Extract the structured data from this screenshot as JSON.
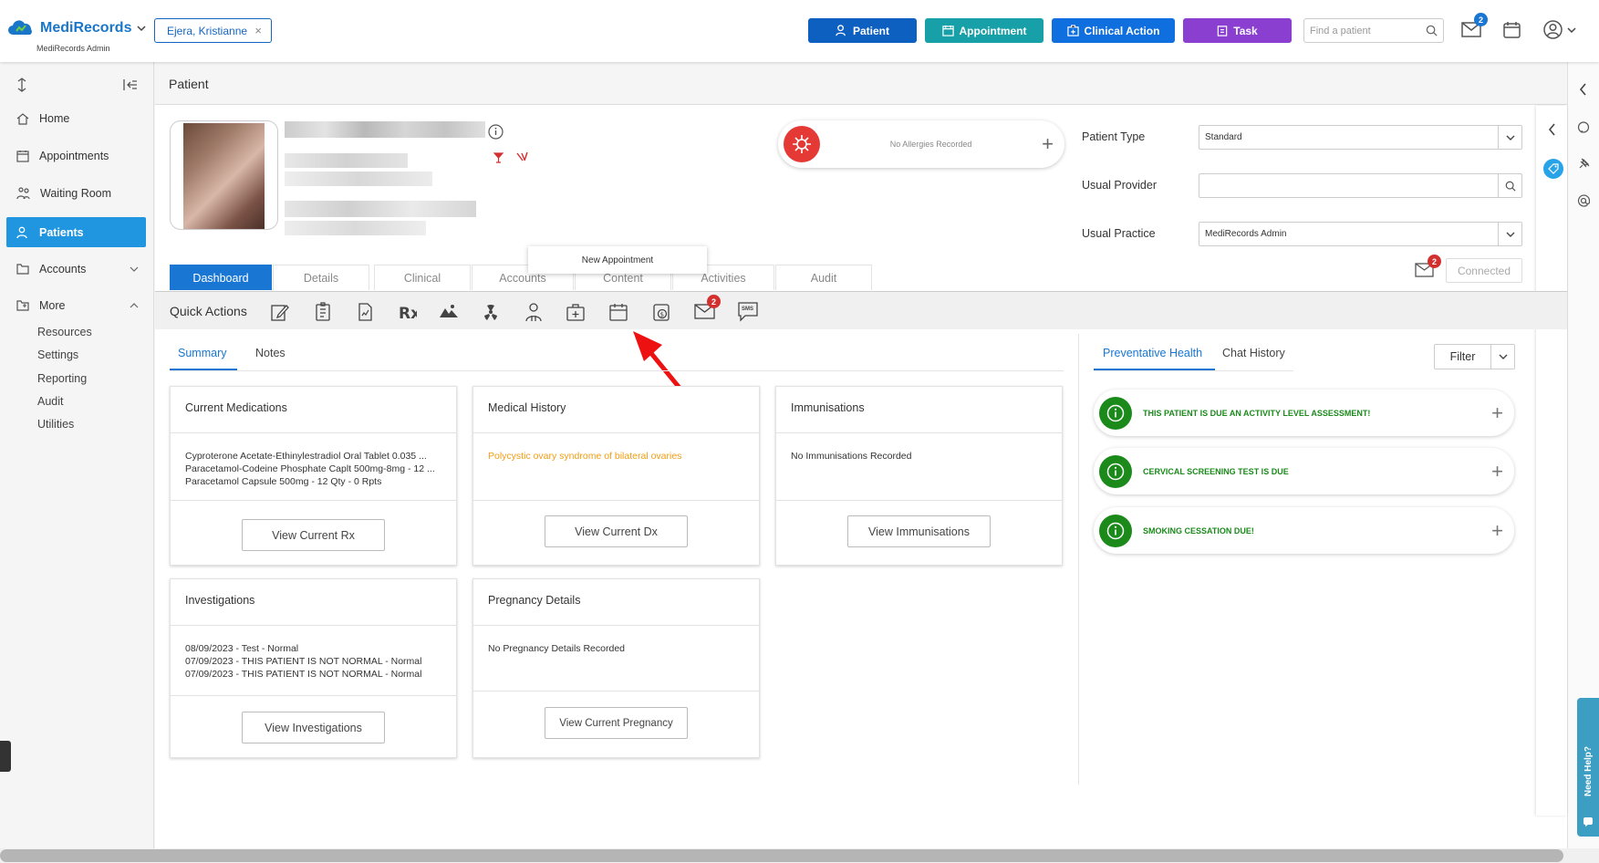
{
  "header": {
    "app_name": "MediRecords",
    "org_name": "MediRecords Admin",
    "patient_chip": "Ejera, Kristianne",
    "buttons": {
      "patient": "Patient",
      "appointment": "Appointment",
      "clinical_action": "Clinical Action",
      "task": "Task"
    },
    "search_placeholder": "Find a patient",
    "mail_count": "2",
    "colors": {
      "patient": "#0d5fc0",
      "appointment": "#17a0a8",
      "clinical_action": "#0f6fde",
      "task": "#8a3fd0"
    }
  },
  "sidebar": {
    "items": [
      {
        "label": "Home",
        "icon": "home-icon"
      },
      {
        "label": "Appointments",
        "icon": "calendar-icon"
      },
      {
        "label": "Waiting Room",
        "icon": "waiting-room-icon"
      },
      {
        "label": "Patients",
        "icon": "patients-icon"
      },
      {
        "label": "Accounts",
        "icon": "folder-icon"
      },
      {
        "label": "More",
        "icon": "more-icon"
      }
    ],
    "sub_items": [
      "Resources",
      "Settings",
      "Reporting",
      "Audit",
      "Utilities"
    ]
  },
  "page": {
    "title": "Patient",
    "allergies": "No Allergies Recorded",
    "fields": {
      "patient_type_label": "Patient Type",
      "patient_type_value": "Standard",
      "usual_provider_label": "Usual Provider",
      "usual_provider_value": "",
      "usual_practice_label": "Usual Practice",
      "usual_practice_value": "MediRecords Admin"
    },
    "connected": "Connected",
    "sms_count": "2"
  },
  "tabs": [
    "Dashboard",
    "Details",
    "Clinical",
    "Accounts",
    "Content",
    "Activities",
    "Audit"
  ],
  "tooltip": "New Appointment",
  "quick_actions": {
    "label": "Quick Actions",
    "mail_count": "2",
    "icons": [
      "edit-icon",
      "document-icon",
      "chart-document-icon",
      "rx-icon",
      "imaging-icon",
      "radiation-icon",
      "referral-icon",
      "medical-case-icon",
      "calendar-icon",
      "billing-icon",
      "mail-icon",
      "sms-icon"
    ],
    "sms_text": "SMS"
  },
  "subtabs": [
    "Summary",
    "Notes"
  ],
  "right_tabs": [
    "Preventative Health",
    "Chat History"
  ],
  "filter_label": "Filter",
  "cards": {
    "current_medications": {
      "title": "Current Medications",
      "lines": [
        "Cyproterone Acetate-Ethinylestradiol Oral Tablet 0.035 ...",
        "Paracetamol-Codeine Phosphate Caplt 500mg-8mg - 12 ...",
        "Paracetamol Capsule 500mg - 12 Qty - 0 Rpts"
      ],
      "button": "View Current Rx"
    },
    "medical_history": {
      "title": "Medical History",
      "lines": [
        "Polycystic ovary syndrome of bilateral ovaries"
      ],
      "button": "View Current Dx"
    },
    "immunisations": {
      "title": "Immunisations",
      "lines": [
        "No Immunisations Recorded"
      ],
      "button": "View Immunisations"
    },
    "investigations": {
      "title": "Investigations",
      "lines": [
        "08/09/2023 - Test - Normal",
        "07/09/2023 - THIS PATIENT IS NOT NORMAL - Normal",
        "07/09/2023 - THIS PATIENT IS NOT NORMAL - Normal"
      ],
      "button": "View Investigations"
    },
    "pregnancy": {
      "title": "Pregnancy Details",
      "lines": [
        "No Pregnancy Details Recorded"
      ],
      "button": "View Current Pregnancy"
    }
  },
  "preventative": [
    "THIS PATIENT IS DUE AN ACTIVITY LEVEL ASSESSMENT!",
    "CERVICAL SCREENING TEST IS DUE",
    "SMOKING CESSATION DUE!"
  ],
  "help_tab": "Need Help?"
}
